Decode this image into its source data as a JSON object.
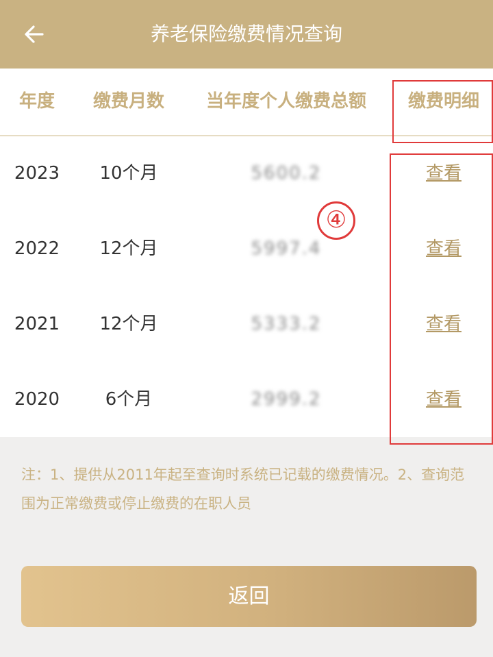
{
  "header": {
    "title": "养老保险缴费情况查询",
    "back_icon": "arrow-left-icon"
  },
  "table": {
    "columns": [
      "年度",
      "缴费月数",
      "当年度个人缴费总额",
      "缴费明细"
    ],
    "rows": [
      {
        "year": "2023",
        "months": "10个月",
        "amount": "5600.2",
        "detail": "查看"
      },
      {
        "year": "2022",
        "months": "12个月",
        "amount": "5997.4",
        "detail": "查看"
      },
      {
        "year": "2021",
        "months": "12个月",
        "amount": "5333.2",
        "detail": "查看"
      },
      {
        "year": "2020",
        "months": "6个月",
        "amount": "2999.2",
        "detail": "查看"
      }
    ]
  },
  "annotation": {
    "number": "④",
    "color": "#e03a3a"
  },
  "note": "注：1、提供从2011年起至查询时系统已记载的缴费情况。2、查询范围为正常缴费或停止缴费的在职人员",
  "footer": {
    "return_label": "返回"
  },
  "colors": {
    "header_bg": "#c9b282",
    "accent": "#c8b07f",
    "link": "#b39965"
  }
}
